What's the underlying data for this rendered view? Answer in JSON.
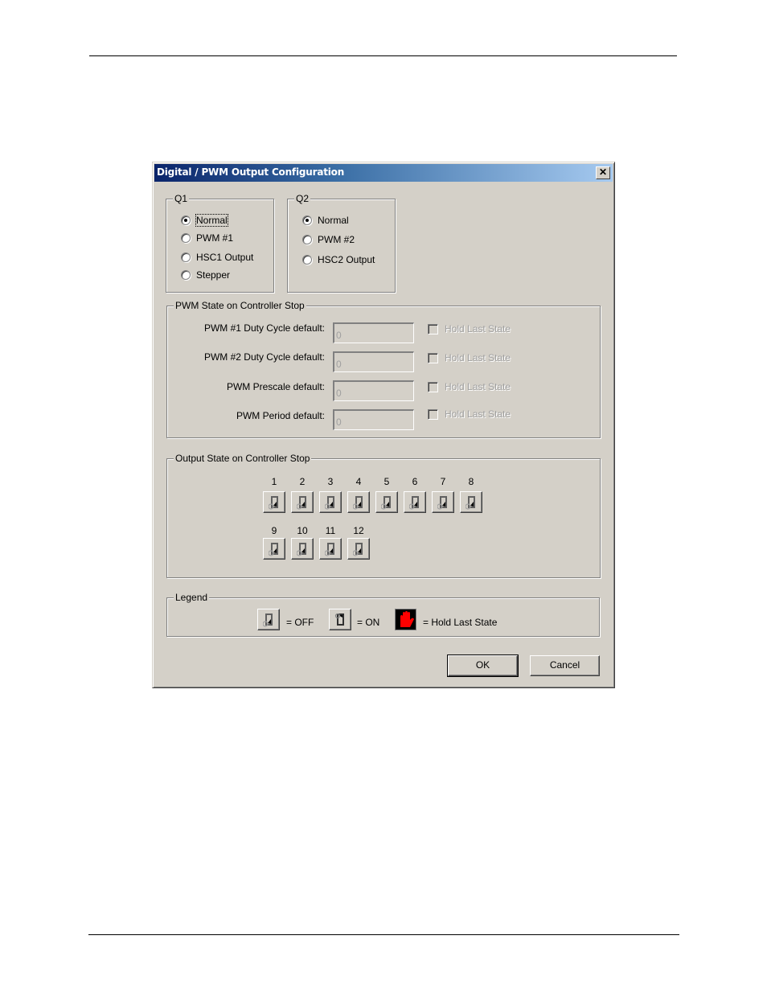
{
  "window": {
    "title": "Digital / PWM Output Configuration",
    "close_icon": "close-icon"
  },
  "q1": {
    "label": "Q1",
    "selected": "Normal",
    "options": [
      "Normal",
      "PWM #1",
      "HSC1 Output",
      "Stepper"
    ]
  },
  "q2": {
    "label": "Q2",
    "selected": "Normal",
    "options": [
      "Normal",
      "PWM #2",
      "HSC2 Output"
    ]
  },
  "pwm_state": {
    "label": "PWM State on Controller Stop",
    "rows": [
      {
        "label": "PWM #1 Duty Cycle default:",
        "value": "0",
        "checkbox": "Hold Last State",
        "checked": false,
        "enabled": false
      },
      {
        "label": "PWM #2 Duty Cycle default:",
        "value": "0",
        "checkbox": "Hold Last State",
        "checked": false,
        "enabled": false
      },
      {
        "label": "PWM Prescale default:",
        "value": "0",
        "checkbox": "Hold Last State",
        "checked": false,
        "enabled": false
      },
      {
        "label": "PWM Period default:",
        "value": "0",
        "checkbox": "Hold Last State",
        "checked": false,
        "enabled": false
      }
    ]
  },
  "output_state": {
    "label": "Output State on Controller Stop",
    "outputs": [
      {
        "num": "1",
        "state": "OFF"
      },
      {
        "num": "2",
        "state": "OFF"
      },
      {
        "num": "3",
        "state": "OFF"
      },
      {
        "num": "4",
        "state": "OFF"
      },
      {
        "num": "5",
        "state": "OFF"
      },
      {
        "num": "6",
        "state": "OFF"
      },
      {
        "num": "7",
        "state": "OFF"
      },
      {
        "num": "8",
        "state": "OFF"
      },
      {
        "num": "9",
        "state": "OFF"
      },
      {
        "num": "10",
        "state": "OFF"
      },
      {
        "num": "11",
        "state": "OFF"
      },
      {
        "num": "12",
        "state": "OFF"
      }
    ]
  },
  "legend": {
    "label": "Legend",
    "off_text": "= OFF",
    "on_text": "= ON",
    "hold_text": "= Hold Last State",
    "hold_color": "#ff0000"
  },
  "buttons": {
    "ok": "OK",
    "cancel": "Cancel"
  },
  "colors": {
    "title_start": "#0a246a",
    "title_end": "#a6caf0",
    "face": "#d4d0c8"
  }
}
